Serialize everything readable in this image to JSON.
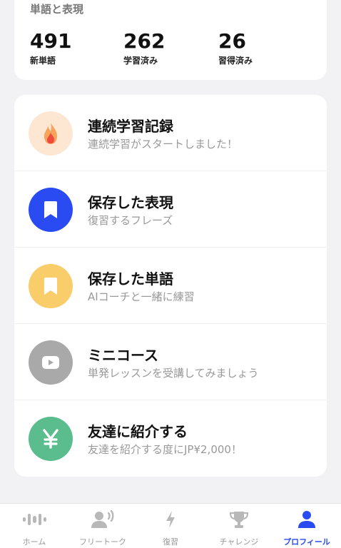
{
  "stats": {
    "title": "単語と表現",
    "items": [
      {
        "value": "491",
        "label": "新単語"
      },
      {
        "value": "262",
        "label": "学習済み"
      },
      {
        "value": "26",
        "label": "習得済み"
      }
    ]
  },
  "menu": [
    {
      "title": "連続学習記録",
      "subtitle": "連続学習がスタートしました！",
      "icon": "flame-icon",
      "color": "#fde6d2"
    },
    {
      "title": "保存した表現",
      "subtitle": "復習するフレーズ",
      "icon": "bookmark-icon",
      "color": "#2b4bf2"
    },
    {
      "title": "保存した単語",
      "subtitle": "AIコーチと一緒に練習",
      "icon": "bookmark-icon",
      "color": "#f8cd6a"
    },
    {
      "title": "ミニコース",
      "subtitle": "単発レッスンを受講してみましょう",
      "icon": "play-icon",
      "color": "#a9a9a9"
    },
    {
      "title": "友達に紹介する",
      "subtitle": "友達を紹介する度にJP¥2,000！",
      "icon": "yen-icon",
      "color": "#5bbd8e"
    }
  ],
  "tabs": [
    {
      "label": "ホーム",
      "icon": "waveform-icon"
    },
    {
      "label": "フリートーク",
      "icon": "speaking-person-icon"
    },
    {
      "label": "復習",
      "icon": "lightning-icon"
    },
    {
      "label": "チャレンジ",
      "icon": "trophy-icon"
    },
    {
      "label": "プロフィール",
      "icon": "person-icon"
    }
  ],
  "colors": {
    "accent": "#2b4bf2",
    "inactive": "#999999"
  }
}
